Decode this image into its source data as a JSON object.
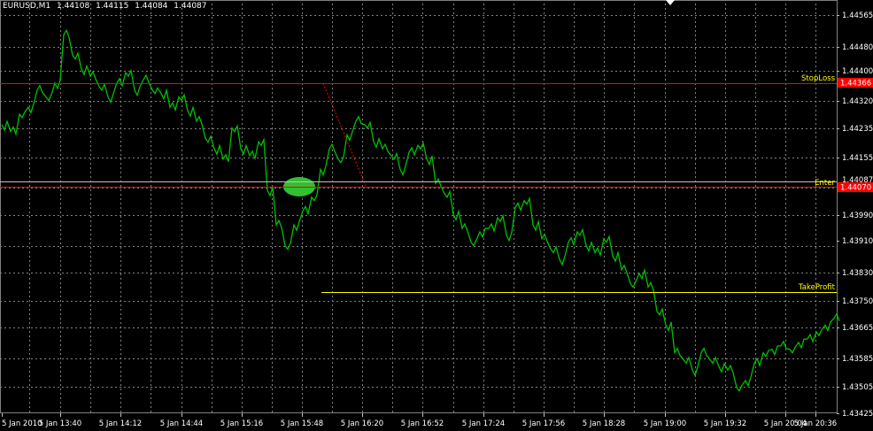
{
  "header": {
    "symbol": "EURUSD,M1",
    "open": "1.44108",
    "high": "1.44115",
    "low": "1.44084",
    "close": "1.44087"
  },
  "lines": {
    "stop_loss": {
      "label": "StopLoss",
      "price_label": "1.44366",
      "color": "#ff0000"
    },
    "entry": {
      "label": "Enter",
      "price_label": "1.44070",
      "color": "#ff0000"
    },
    "bid": {
      "price_label": "1.44087",
      "color": "#c0c0c0"
    },
    "take_profit": {
      "label": "TakeProfit",
      "color": "#ffff00"
    }
  },
  "chart_data": {
    "type": "line",
    "price_ticks": [
      "1.44565",
      "1.44480",
      "1.44400",
      "1.44320",
      "1.44235",
      "1.44155",
      "1.43990",
      "1.43910",
      "1.43830",
      "1.43750",
      "1.43665",
      "1.43585",
      "1.43505",
      "1.43425"
    ],
    "time_ticks": [
      "5 Jan 2010",
      "5 Jan 13:40",
      "5 Jan 14:12",
      "5 Jan 14:44",
      "5 Jan 15:16",
      "5 Jan 15:48",
      "5 Jan 16:20",
      "5 Jan 16:52",
      "5 Jan 17:24",
      "5 Jan 17:56",
      "5 Jan 18:28",
      "5 Jan 19:00",
      "5 Jan 19:32",
      "5 Jan 20:04",
      "5 Jan 20:36"
    ],
    "ylim": [
      1.43425,
      1.4461
    ],
    "series_color": "#00c000",
    "grid": true,
    "x": [
      0,
      10,
      20,
      30,
      40,
      50,
      60,
      70,
      80,
      90,
      100,
      110,
      120,
      130,
      140,
      150,
      160,
      170,
      180,
      190,
      200,
      210,
      220,
      230,
      240,
      250,
      260,
      270,
      280,
      290,
      300,
      310,
      320,
      330,
      340,
      350,
      360,
      370,
      380,
      390,
      400,
      410,
      420,
      430,
      440,
      450,
      460,
      470,
      480,
      490,
      500,
      510,
      520,
      530,
      540,
      550,
      560,
      570,
      580,
      590,
      600,
      610,
      620,
      630,
      640,
      650,
      660,
      670,
      680,
      690,
      700,
      710,
      720,
      730,
      740,
      750,
      760,
      770,
      780,
      790,
      800,
      810,
      820,
      830,
      840,
      850,
      860,
      870,
      880,
      890,
      900,
      910,
      920,
      930,
      940
    ],
    "values": [
      1.4426,
      1.4424,
      1.4429,
      1.4431,
      1.4436,
      1.4434,
      1.4438,
      1.4452,
      1.4446,
      1.4442,
      1.444,
      1.4437,
      1.4434,
      1.4438,
      1.4441,
      1.4436,
      1.4439,
      1.4436,
      1.4435,
      1.4431,
      1.4434,
      1.443,
      1.4427,
      1.4422,
      1.4419,
      1.4416,
      1.4425,
      1.4419,
      1.4417,
      1.4421,
      1.4407,
      1.4397,
      1.4391,
      1.4397,
      1.4401,
      1.4405,
      1.4413,
      1.4419,
      1.4416,
      1.4423,
      1.4427,
      1.4426,
      1.4421,
      1.4419,
      1.4417,
      1.4413,
      1.4418,
      1.442,
      1.4416,
      1.4409,
      1.4406,
      1.44,
      1.4396,
      1.4392,
      1.4395,
      1.4396,
      1.4399,
      1.4394,
      1.4402,
      1.4404,
      1.4397,
      1.4393,
      1.439,
      1.4387,
      1.4392,
      1.4395,
      1.4391,
      1.4389,
      1.4393,
      1.4388,
      1.4384,
      1.438,
      1.4383,
      1.4379,
      1.4372,
      1.4368,
      1.436,
      1.4358,
      1.4355,
      1.436,
      1.4358,
      1.4356,
      1.4355,
      1.435,
      1.4352,
      1.4357,
      1.436,
      1.4361,
      1.4362,
      1.4361,
      1.4363,
      1.4364,
      1.4366,
      1.4368,
      1.437
    ]
  }
}
